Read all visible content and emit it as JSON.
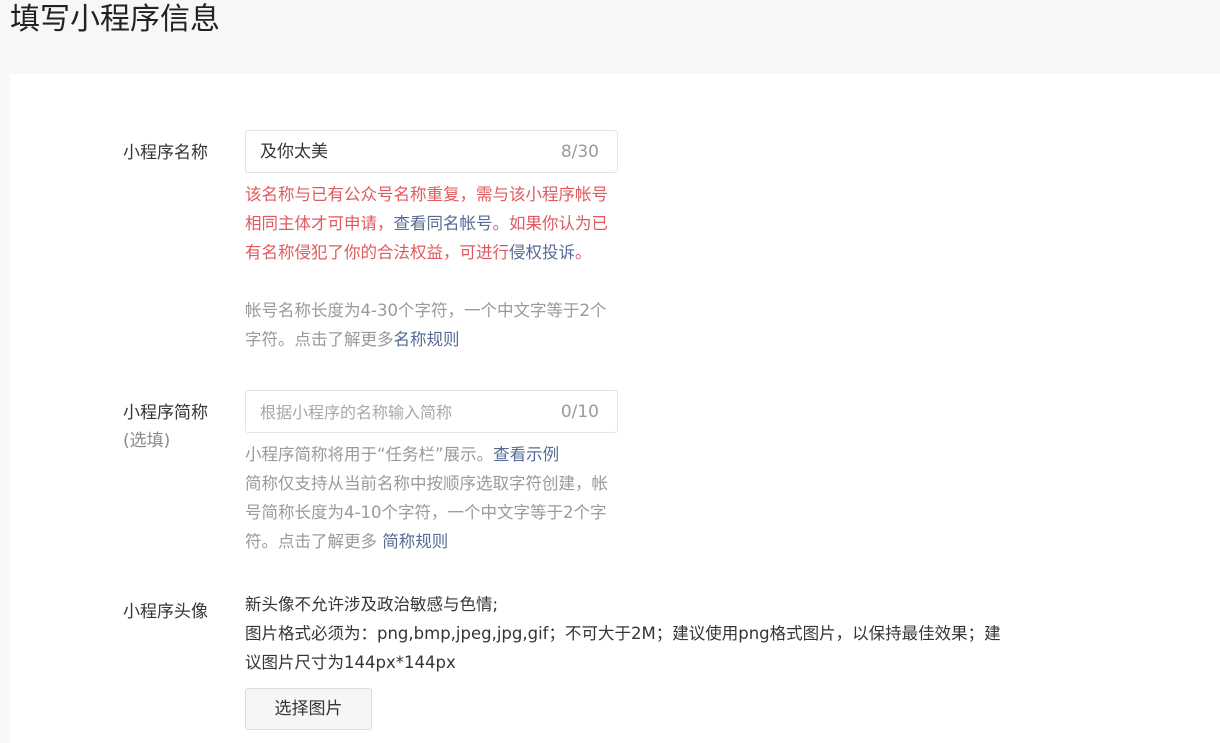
{
  "page": {
    "title": "填写小程序信息"
  },
  "name_field": {
    "label": "小程序名称",
    "value": "及你太美",
    "counter": "8/30",
    "error_part1": "该名称与已有公众号名称重复，需与该小程序帐号相同主体才可申请，",
    "error_link1": "查看同名帐号",
    "error_part2": "。如果你认为已有名称侵犯了你的合法权益，可进行",
    "error_link2": "侵权投诉",
    "error_part3": "。",
    "hint_text": "帐号名称长度为4-30个字符，一个中文字等于2个字符。点击了解更多",
    "hint_link": "名称规则"
  },
  "short_name_field": {
    "label": "小程序简称",
    "optional": "(选填)",
    "placeholder": "根据小程序的名称输入简称",
    "counter": "0/10",
    "hint_part1": "小程序简称将用于“任务栏”展示。",
    "hint_link1": "查看示例",
    "hint_part2": "简称仅支持从当前名称中按顺序选取字符创建，帐号简称长度为4-10个字符，一个中文字等于2个字符。点击了解更多 ",
    "hint_link2": "简称规则"
  },
  "avatar_field": {
    "label": "小程序头像",
    "desc_line1": "新头像不允许涉及政治敏感与色情;",
    "desc_line2": "图片格式必须为：png,bmp,jpeg,jpg,gif；不可大于2M；建议使用png格式图片，以保持最佳效果；建议图片尺寸为144px*144px",
    "button_label": "选择图片"
  }
}
